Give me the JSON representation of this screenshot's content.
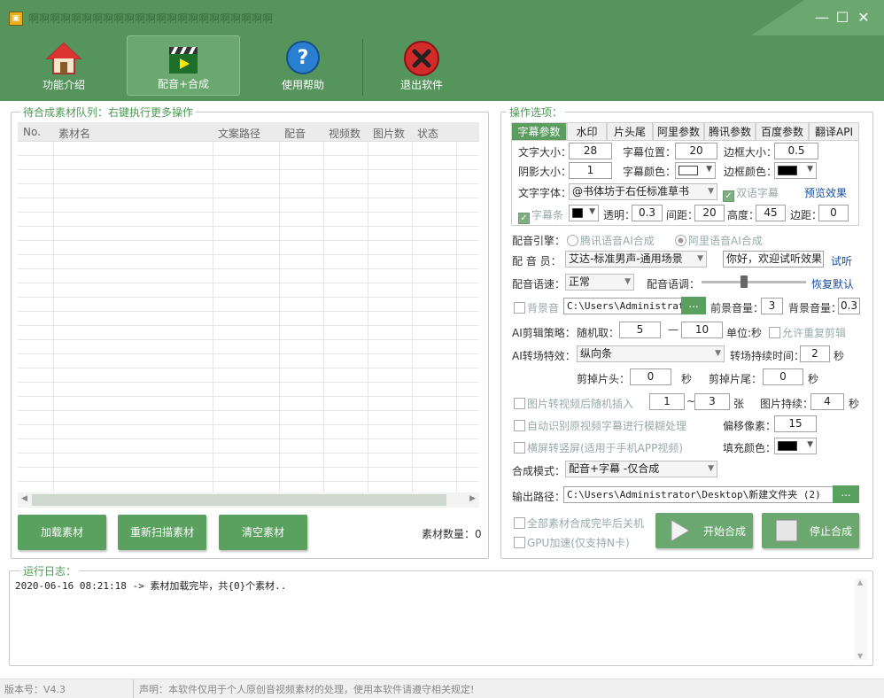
{
  "window": {
    "title": "啊啊啊啊啊啊啊啊啊啊啊啊啊啊啊啊啊啊啊啊啊啊啊",
    "minimize": "—",
    "maximize": "☐",
    "close": "✕"
  },
  "toolbar": {
    "items": [
      {
        "label": "功能介绍",
        "icon": "home-icon"
      },
      {
        "label": "配音+合成",
        "icon": "clapperboard-icon"
      },
      {
        "label": "使用帮助",
        "icon": "help-icon"
      },
      {
        "label": "退出软件",
        "icon": "exit-icon"
      }
    ]
  },
  "queue": {
    "legend": "待合成素材队列：右键执行更多操作",
    "columns": [
      "No.",
      "素材名",
      "文案路径",
      "配音",
      "视频数",
      "图片数",
      "状态"
    ],
    "buttons": {
      "load": "加载素材",
      "rescan": "重新扫描素材",
      "clear": "清空素材"
    },
    "count_label": "素材数量：0"
  },
  "options": {
    "legend": "操作选项：",
    "tabs": [
      "字幕参数",
      "水印",
      "片头尾",
      "阿里参数",
      "腾讯参数",
      "百度参数",
      "翻译API"
    ],
    "subtitle": {
      "font_size_label": "文字大小：",
      "font_size": "28",
      "position_label": "字幕位置：",
      "position": "20",
      "border_size_label": "边框大小：",
      "border_size": "0.5",
      "shadow_label": "阴影大小：",
      "shadow": "1",
      "color_label": "字幕颜色：",
      "color": "#ffffff",
      "border_color_label": "边框颜色：",
      "border_color": "#000000",
      "font_label": "文字字体：",
      "font": "@书体坊于右任标准草书",
      "bilingual_label": "双语字幕",
      "preview_label": "预览效果",
      "bar_label": "字幕条",
      "bar_color": "#000000",
      "alpha_label": "透明：",
      "alpha": "0.3",
      "spacing_label": "间距：",
      "spacing": "20",
      "height_label": "高度：",
      "height": "45",
      "margin_label": "边距：",
      "margin": "0"
    },
    "engine_label": "配音引擎：",
    "engine_tencent": "腾讯语音AI合成",
    "engine_ali": "阿里语音AI合成",
    "voice_label": "配 音 员：",
    "voice": "艾达-标准男声-通用场景",
    "try_text": "你好，欢迎试听效果",
    "try_label": "试听",
    "speed_label": "配音语速：",
    "speed": "正常",
    "pitch_label": "配音语调：",
    "pitch_level": 0.4,
    "reset_label": "恢复默认",
    "bgm_label": "背景音",
    "bgm_path": "C:\\Users\\Administrator",
    "browse": "...",
    "fg_volume_label": "前景音量：",
    "fg_volume": "3",
    "bg_volume_label": "背景音量：",
    "bg_volume": "0.3",
    "cut_label": "AI剪辑策略：",
    "random_label": "随机取：",
    "random_min": "5",
    "dash": "—",
    "random_max": "10",
    "unit_label": "单位:秒",
    "allow_repeat_label": "允许重复剪辑",
    "transition_label": "AI转场特效：",
    "transition": "纵向条",
    "transition_duration_label": "转场持续时间：",
    "transition_duration": "2",
    "sec": "秒",
    "cut_head_label": "剪掉片头：",
    "cut_head": "0",
    "cut_tail_label": "剪掉片尾：",
    "cut_tail": "0",
    "img_insert_label": "图片转视频后随机插入",
    "img_min": "1",
    "tilde": "~",
    "img_max": "3",
    "zhang": "张",
    "img_duration_label": "图片持续：",
    "img_duration": "4",
    "blur_label": "自动识别原视频字幕进行模糊处理",
    "offset_label": "偏移像素：",
    "offset": "15",
    "landscape_label": "横屏转竖屏(适用于手机APP视频)",
    "fill_color_label": "填充颜色：",
    "fill_color": "#000000",
    "mode_label": "合成模式：",
    "mode": "配音+字幕 -仅合成",
    "output_label": "输出路径：",
    "output_path": "C:\\Users\\Administrator\\Desktop\\新建文件夹 (2)",
    "shutdown_label": "全部素材合成完毕后关机",
    "gpu_label": "GPU加速(仅支持N卡)",
    "start_label": "开始合成",
    "stop_label": "停止合成"
  },
  "log": {
    "legend": "运行日志：",
    "lines": [
      "2020-06-16 08:21:18 -> 素材加载完毕，共{0}个素材.."
    ]
  },
  "status": {
    "version": "版本号：V4.3",
    "notice": "声明：本软件仅用于个人原创音视频素材的处理，使用本软件请遵守相关规定!"
  },
  "colors": {
    "brand_green": "#55955b",
    "accent_green": "#5aa05f"
  }
}
